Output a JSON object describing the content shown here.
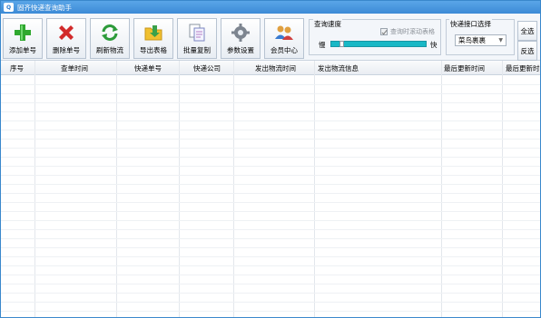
{
  "window": {
    "title": "固齐快递查询助手",
    "icon_text": "Q"
  },
  "toolbar": {
    "buttons": [
      {
        "label": "添加单号",
        "icon": "add-green-plus-icon"
      },
      {
        "label": "删除单号",
        "icon": "delete-red-x-icon"
      },
      {
        "label": "刷新物流",
        "icon": "refresh-green-arrows-icon"
      },
      {
        "label": "导出表格",
        "icon": "export-folder-icon"
      },
      {
        "label": "批量复制",
        "icon": "copy-documents-icon"
      },
      {
        "label": "参数设置",
        "icon": "settings-gear-icon"
      },
      {
        "label": "会员中心",
        "icon": "member-center-icon"
      }
    ]
  },
  "speed": {
    "title": "查询速度",
    "slow_label": "慢",
    "fast_label": "快",
    "scroll_checkbox": "查询时滚动表格",
    "scroll_checked": true,
    "level": 0.1
  },
  "api": {
    "title": "快递接口选择",
    "selected": "菜鸟裹裹"
  },
  "side_buttons": {
    "select_all": "全选",
    "invert": "反选"
  },
  "table": {
    "columns": [
      "序号",
      "查单时间",
      "快递单号",
      "快递公司",
      "发出物流时间",
      "发出物流信息",
      "最后更新时间",
      "最后更新时"
    ]
  },
  "colors": {
    "title_bar": "#3c8ad6",
    "slider": "#18b8c6",
    "add_icon": "#2fa82f",
    "delete_icon": "#d22a2a"
  }
}
